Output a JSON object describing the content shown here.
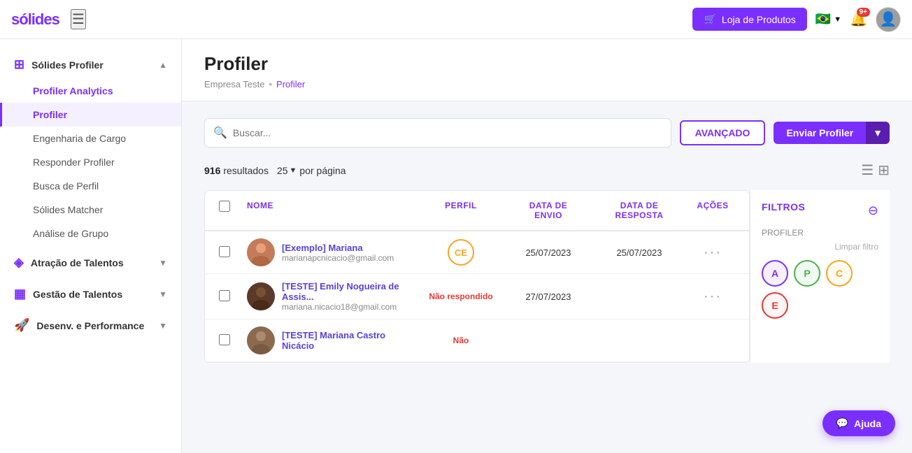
{
  "app": {
    "logo": "sólides",
    "shop_button": "Loja de Produtos",
    "notification_count": "9+",
    "flag": "🇧🇷"
  },
  "sidebar": {
    "sections": [
      {
        "id": "profiler",
        "label": "Sólides Profiler",
        "icon": "grid-icon",
        "expanded": true,
        "items": [
          {
            "id": "profiler-analytics",
            "label": "Profiler Analytics",
            "active": false
          },
          {
            "id": "profiler",
            "label": "Profiler",
            "active": true
          },
          {
            "id": "engenharia-de-cargo",
            "label": "Engenharia de Cargo",
            "active": false
          },
          {
            "id": "responder-profiler",
            "label": "Responder Profiler",
            "active": false
          },
          {
            "id": "busca-de-perfil",
            "label": "Busca de Perfil",
            "active": false
          },
          {
            "id": "solides-matcher",
            "label": "Sólides Matcher",
            "active": false
          },
          {
            "id": "analise-de-grupo",
            "label": "Análise de Grupo",
            "active": false
          }
        ]
      },
      {
        "id": "atracao",
        "label": "Atração de Talentos",
        "icon": "layers-icon",
        "expanded": false,
        "items": []
      },
      {
        "id": "gestao",
        "label": "Gestão de Talentos",
        "icon": "chart-icon",
        "expanded": false,
        "items": []
      },
      {
        "id": "desenv",
        "label": "Desenv. e Performance",
        "icon": "rocket-icon",
        "expanded": false,
        "items": []
      }
    ]
  },
  "page": {
    "title": "Profiler",
    "breadcrumb": [
      {
        "label": "Empresa Teste",
        "active": false
      },
      {
        "sep": "•"
      },
      {
        "label": "Profiler",
        "active": true
      }
    ]
  },
  "toolbar": {
    "search_placeholder": "Buscar...",
    "avancado_label": "AVANÇADO",
    "enviar_label": "Enviar Profiler"
  },
  "results": {
    "count": "916",
    "count_label": "resultados",
    "per_page": "25",
    "per_page_label": "por página"
  },
  "table": {
    "columns": [
      {
        "id": "checkbox",
        "label": ""
      },
      {
        "id": "nome",
        "label": "NOME"
      },
      {
        "id": "perfil",
        "label": "PERFIL"
      },
      {
        "id": "data_envio",
        "label": "DATA DE ENVIO"
      },
      {
        "id": "data_resposta",
        "label": "DATA DE RESPOSTA"
      },
      {
        "id": "acoes",
        "label": "AÇÕES"
      }
    ],
    "rows": [
      {
        "id": 1,
        "name": "[Exemplo] Mariana",
        "email": "marianapcnicacio@gmail.com",
        "profile_code": "CE",
        "profile_color": "#f5a623",
        "data_envio": "25/07/2023",
        "data_resposta": "25/07/2023",
        "status": "",
        "avatar_bg": "#c47b5a"
      },
      {
        "id": 2,
        "name": "[TESTE] Emily Nogueira de Assis...",
        "email": "mariana.nicacio18@gmail.com",
        "profile_code": "",
        "profile_color": "",
        "data_envio": "27/07/2023",
        "data_resposta": "",
        "status": "Não respondido",
        "status_color": "#e53935",
        "avatar_bg": "#5a3a2a"
      },
      {
        "id": 3,
        "name": "[TESTE] Mariana Castro Nicácio",
        "email": "",
        "profile_code": "",
        "profile_color": "",
        "data_envio": "",
        "data_resposta": "",
        "status": "Não",
        "status_color": "#e53935",
        "avatar_bg": "#8b6a50"
      }
    ]
  },
  "filters": {
    "title": "FILTROS",
    "section_label": "PROFILER",
    "clear_label": "Limpar filtro",
    "badges": [
      {
        "id": "A",
        "label": "A",
        "class": "fb-a"
      },
      {
        "id": "P",
        "label": "P",
        "class": "fb-p"
      },
      {
        "id": "C",
        "label": "C",
        "class": "fb-c"
      },
      {
        "id": "E",
        "label": "E",
        "class": "fb-e"
      }
    ]
  },
  "ajuda": {
    "label": "Ajuda"
  }
}
